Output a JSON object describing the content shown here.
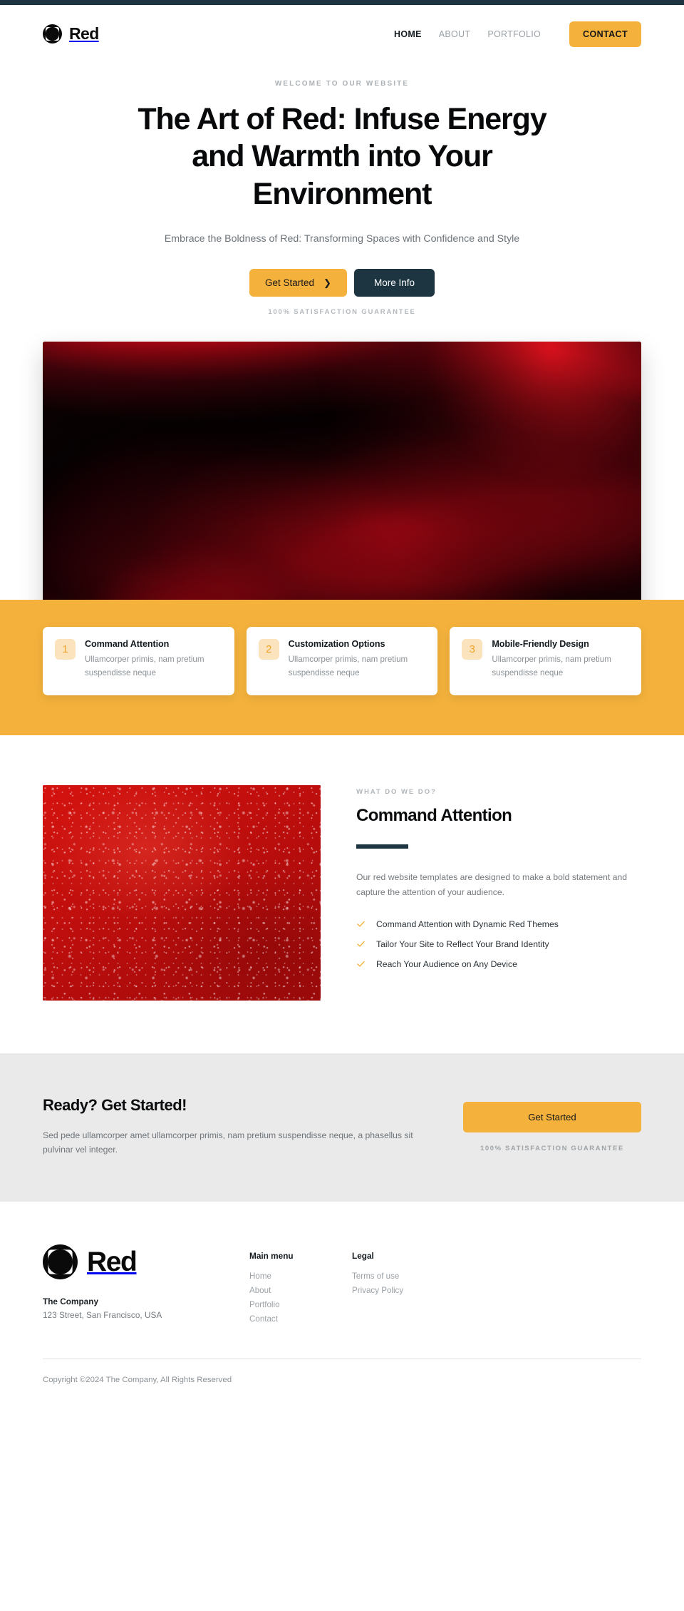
{
  "colors": {
    "accent": "#f4b23c",
    "dark": "#1d3540",
    "band": "#f4b23c",
    "cta_bg": "#eaeaea",
    "muted_text": "#9aa1a6",
    "red_image": "#c8100f"
  },
  "header": {
    "brand_name": "Red",
    "logo_icon": "red-flower-logo-icon",
    "nav": [
      {
        "label": "HOME",
        "active": true
      },
      {
        "label": "ABOUT",
        "active": false
      },
      {
        "label": "PORTFOLIO",
        "active": false
      }
    ],
    "cta_label": "CONTACT"
  },
  "hero": {
    "eyebrow": "WELCOME TO OUR WEBSITE",
    "title": "The Art of Red: Infuse Energy and Warmth into Your Environment",
    "subtitle": "Embrace the Boldness of Red: Transforming Spaces with Confidence and Style",
    "primary_button": "Get Started",
    "primary_button_icon": "chevron-right-icon",
    "secondary_button": "More Info",
    "guarantee": "100% SATISFACTION GUARANTEE",
    "image_alt": "abstract-red-curves-image"
  },
  "feature_cards": [
    {
      "number": "1",
      "title": "Command Attention",
      "text": "Ullamcorper primis, nam pretium suspendisse neque"
    },
    {
      "number": "2",
      "title": "Customization Options",
      "text": "Ullamcorper primis, nam pretium suspendisse neque"
    },
    {
      "number": "3",
      "title": "Mobile-Friendly Design",
      "text": "Ullamcorper primis, nam pretium suspendisse neque"
    }
  ],
  "feature": {
    "eyebrow": "WHAT DO WE DO?",
    "title": "Command Attention",
    "text": "Our red website templates are designed to make a bold statement and capture the attention of your audience.",
    "image_alt": "red-water-droplets-image",
    "checklist": [
      "Command Attention with Dynamic Red Themes",
      "Tailor Your Site to Reflect Your Brand Identity",
      "Reach Your Audience on Any Device"
    ]
  },
  "cta": {
    "title": "Ready? Get Started!",
    "text": "Sed pede ullamcorper amet ullamcorper primis, nam pretium suspendisse neque, a phasellus sit pulvinar vel integer.",
    "button": "Get Started",
    "guarantee": "100% SATISFACTION GUARANTEE"
  },
  "footer": {
    "brand_name": "Red",
    "logo_icon": "red-flower-logo-icon",
    "company": "The Company",
    "address": "123 Street, San Francisco, USA",
    "columns": [
      {
        "title": "Main menu",
        "links": [
          "Home",
          "About",
          "Portfolio",
          "Contact"
        ]
      },
      {
        "title": "Legal",
        "links": [
          "Terms of use",
          "Privacy Policy"
        ]
      }
    ],
    "copyright": "Copyright ©2024 The Company, All Rights Reserved"
  }
}
